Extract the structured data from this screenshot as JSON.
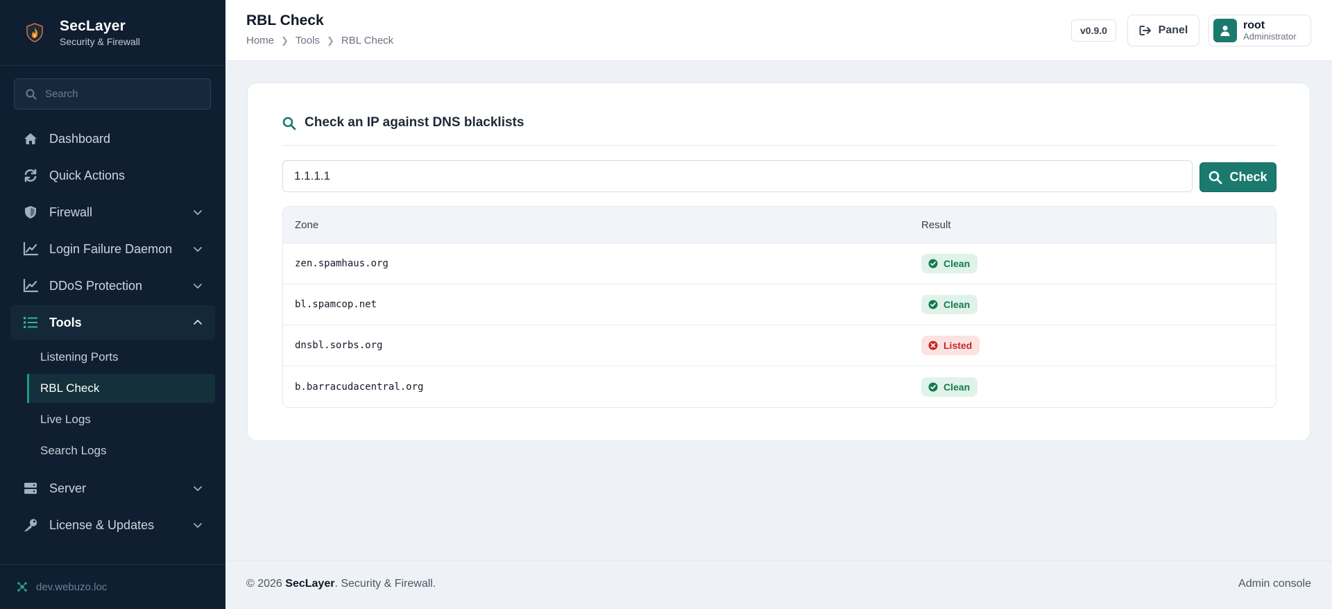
{
  "app": {
    "name": "SecLayer",
    "tagline": "Security & Firewall"
  },
  "sidebar": {
    "search_placeholder": "Search",
    "items": [
      {
        "label": "Dashboard",
        "icon": "home-icon"
      },
      {
        "label": "Quick Actions",
        "icon": "refresh-icon"
      },
      {
        "label": "Firewall",
        "icon": "shield-icon"
      },
      {
        "label": "Login Failure Daemon",
        "icon": "chart-line-icon"
      },
      {
        "label": "DDoS Protection",
        "icon": "chart-line-icon"
      },
      {
        "label": "Tools",
        "icon": "list-icon"
      }
    ],
    "tools_sub": [
      {
        "label": "Listening Ports"
      },
      {
        "label": "RBL Check"
      },
      {
        "label": "Live Logs"
      },
      {
        "label": "Search Logs"
      }
    ],
    "items_after": [
      {
        "label": "Server",
        "icon": "server-icon"
      },
      {
        "label": "License & Updates",
        "icon": "key-icon"
      }
    ],
    "hostname": "dev.webuzo.loc"
  },
  "header": {
    "title": "RBL Check",
    "breadcrumb": [
      "Home",
      "Tools",
      "RBL Check"
    ],
    "version": "v0.9.0",
    "panel_label": "Panel",
    "user": {
      "name": "root",
      "role": "Administrator"
    }
  },
  "main": {
    "card_title": "Check an IP against DNS blacklists",
    "ip_value": "1.1.1.1",
    "check_label": "Check",
    "table": {
      "columns": [
        "Zone",
        "Result"
      ],
      "rows": [
        {
          "zone": "zen.spamhaus.org",
          "result": "Clean",
          "status": "clean"
        },
        {
          "zone": "bl.spamcop.net",
          "result": "Clean",
          "status": "clean"
        },
        {
          "zone": "dnsbl.sorbs.org",
          "result": "Listed",
          "status": "listed"
        },
        {
          "zone": "b.barracudacentral.org",
          "result": "Clean",
          "status": "clean"
        }
      ]
    }
  },
  "footer": {
    "copyright_prefix": "© 2026 ",
    "brand": "SecLayer",
    "suffix": ". Security & Firewall.",
    "right": "Admin console"
  },
  "colors": {
    "sidebar_bg": "#0f1e31",
    "accent": "#1a7a6e",
    "clean": "#16794f",
    "listed": "#c62828"
  }
}
